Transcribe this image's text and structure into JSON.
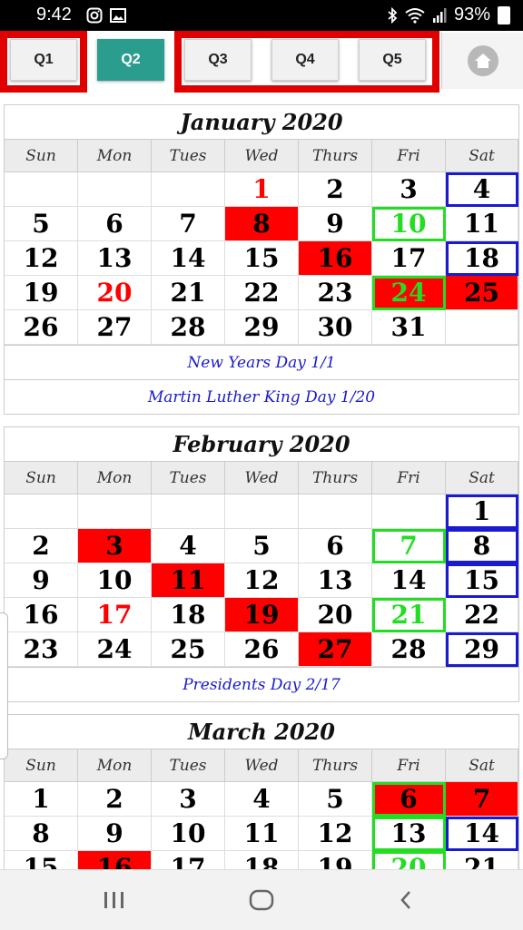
{
  "status": {
    "time": "9:42",
    "battery": "93%"
  },
  "tabs": [
    {
      "label": "Q1",
      "active": false
    },
    {
      "label": "Q2",
      "active": true
    },
    {
      "label": "Q3",
      "active": false
    },
    {
      "label": "Q4",
      "active": false
    },
    {
      "label": "Q5",
      "active": false
    }
  ],
  "home_icon": "home-icon",
  "weekdays": [
    "Sun",
    "Mon",
    "Tues",
    "Wed",
    "Thurs",
    "Fri",
    "Sat"
  ],
  "months": [
    {
      "title": "January 2020",
      "startCol": 3,
      "days": 31,
      "rowsToShow": 5,
      "marks": {
        "1": [
          "txtr"
        ],
        "4": [
          "boxb"
        ],
        "8": [
          "red"
        ],
        "10": [
          "boxg",
          "txtg"
        ],
        "16": [
          "red"
        ],
        "18": [
          "boxb"
        ],
        "20": [
          "txtr"
        ],
        "24": [
          "red",
          "boxg",
          "txtg"
        ],
        "25": [
          "red"
        ]
      },
      "holidays": [
        "New Years Day 1/1",
        "Martin Luther King Day 1/20"
      ]
    },
    {
      "title": "February 2020",
      "startCol": 6,
      "days": 29,
      "rowsToShow": 5,
      "marks": {
        "1": [
          "boxb"
        ],
        "3": [
          "red"
        ],
        "7": [
          "boxg",
          "txtg"
        ],
        "8": [
          "boxb"
        ],
        "11": [
          "red"
        ],
        "15": [
          "boxb"
        ],
        "17": [
          "txtr"
        ],
        "19": [
          "red"
        ],
        "21": [
          "boxg",
          "txtg"
        ],
        "27": [
          "red"
        ],
        "29": [
          "boxb"
        ]
      },
      "holidays": [
        "Presidents Day 2/17"
      ]
    },
    {
      "title": "March 2020",
      "startCol": 0,
      "days": 31,
      "rowsToShow": 3,
      "marks": {
        "6": [
          "red",
          "boxg"
        ],
        "7": [
          "red"
        ],
        "13": [
          "boxg"
        ],
        "14": [
          "boxb"
        ],
        "16": [
          "red"
        ],
        "20": [
          "boxg",
          "txtg"
        ]
      },
      "holidays": []
    }
  ],
  "colors": {
    "accent": "#2a9d8f",
    "highlight": "#ff0000",
    "payday": "#22dd22",
    "weekend": "#1a1ad0",
    "holiday_text": "#1a1acc"
  },
  "nav": {
    "recents_icon": "recents-icon",
    "home_icon": "nav-home-icon",
    "back_icon": "back-icon"
  }
}
